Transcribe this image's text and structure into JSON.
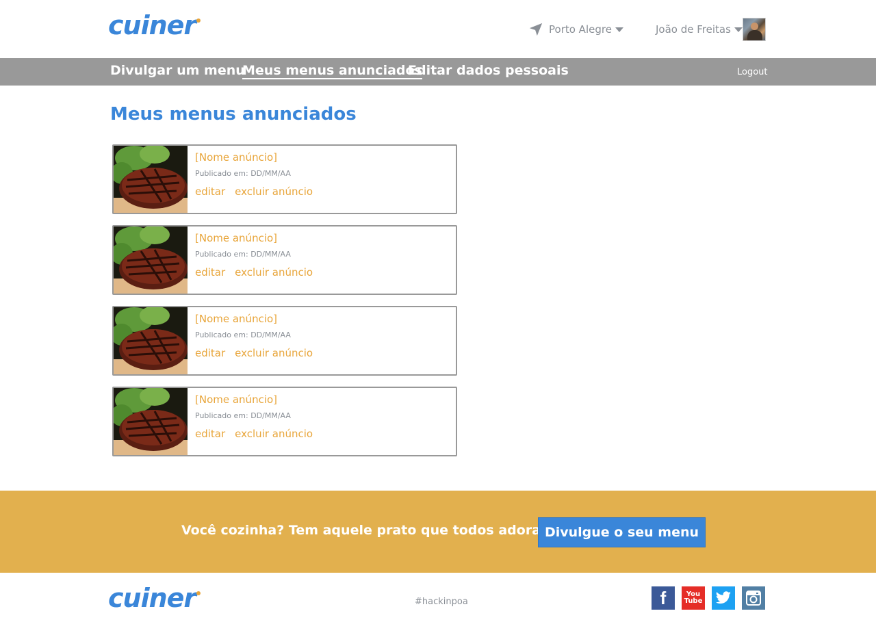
{
  "header": {
    "logo_text": "cuiner",
    "location": "Porto Alegre",
    "user_name": "João de Freitas"
  },
  "nav": {
    "items": [
      {
        "label": "Divulgar um menu"
      },
      {
        "label": "Meus menus anunciados"
      },
      {
        "label": "Editar dados pessoais"
      }
    ],
    "logout": "Logout"
  },
  "main": {
    "title": "Meus menus anunciados",
    "listings": [
      {
        "name": "[Nome anúncio]",
        "date": "Publicado em: DD/MM/AA",
        "edit": "editar",
        "delete": "excluir anúncio"
      },
      {
        "name": "[Nome anúncio]",
        "date": "Publicado em: DD/MM/AA",
        "edit": "editar",
        "delete": "excluir anúncio"
      },
      {
        "name": "[Nome anúncio]",
        "date": "Publicado em: DD/MM/AA",
        "edit": "editar",
        "delete": "excluir anúncio"
      },
      {
        "name": "[Nome anúncio]",
        "date": "Publicado em: DD/MM/AA",
        "edit": "editar",
        "delete": "excluir anúncio"
      }
    ]
  },
  "cta": {
    "text": "Você cozinha? Tem aquele prato que todos adoram comer?",
    "button": "Divulgue o seu menu"
  },
  "footer": {
    "logo_text": "cuiner",
    "hashtag": "#hackinpoa",
    "social": [
      {
        "icon": "facebook-icon",
        "glyph": "f"
      },
      {
        "icon": "youtube-icon",
        "glyph_top": "You",
        "glyph_bottom": "Tube"
      },
      {
        "icon": "twitter-icon"
      },
      {
        "icon": "instagram-icon"
      }
    ]
  },
  "colors": {
    "brand_blue": "#3a86d9",
    "accent_orange": "#e8a53a",
    "nav_gray": "#999999",
    "cta_yellow": "#e2b04e"
  }
}
